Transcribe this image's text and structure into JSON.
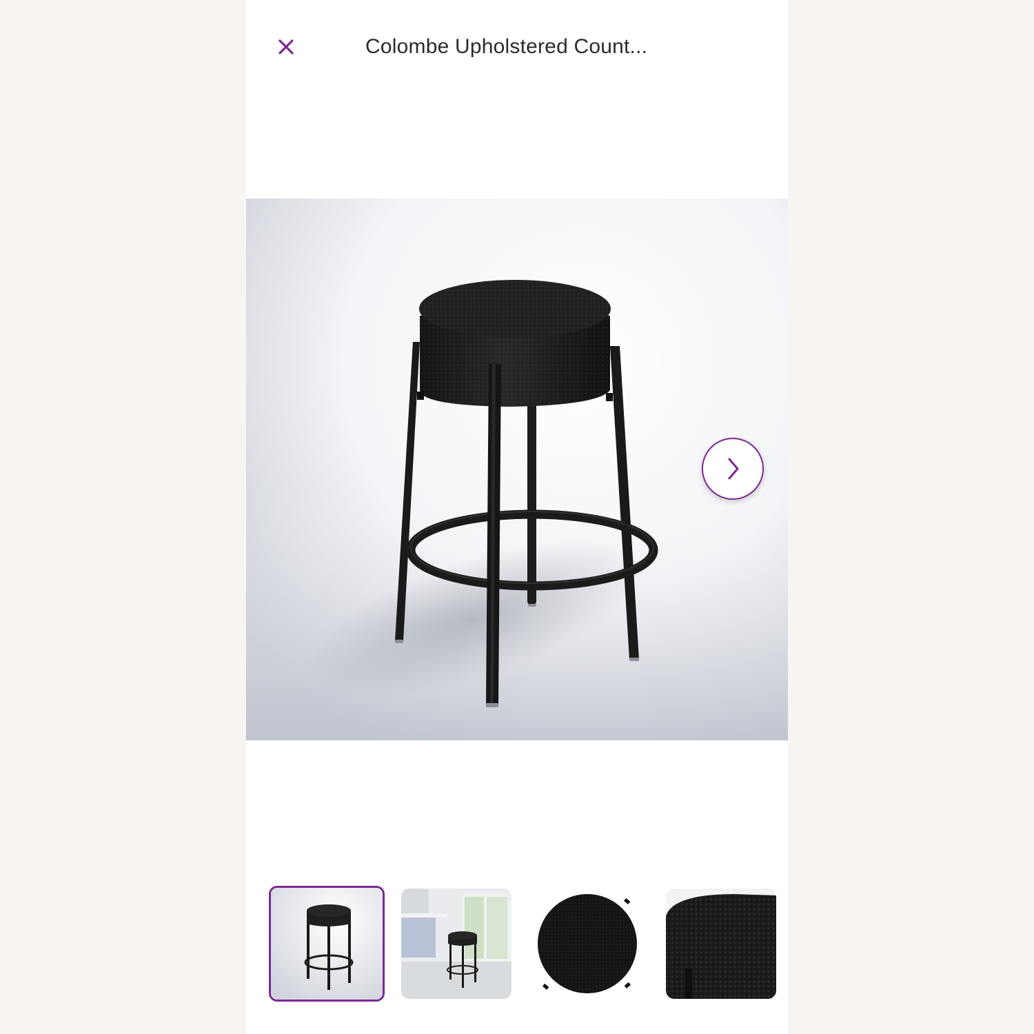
{
  "header": {
    "title": "Colombe Upholstered Count..."
  },
  "gallery": {
    "selected_index": 0,
    "thumbnail_count": 4
  },
  "colors": {
    "accent": "#7b2a92",
    "page_background": "#f8f4f1",
    "upholstery": "#1f1f1f"
  },
  "icons": {
    "close": "close-icon",
    "next": "chevron-right-icon"
  }
}
